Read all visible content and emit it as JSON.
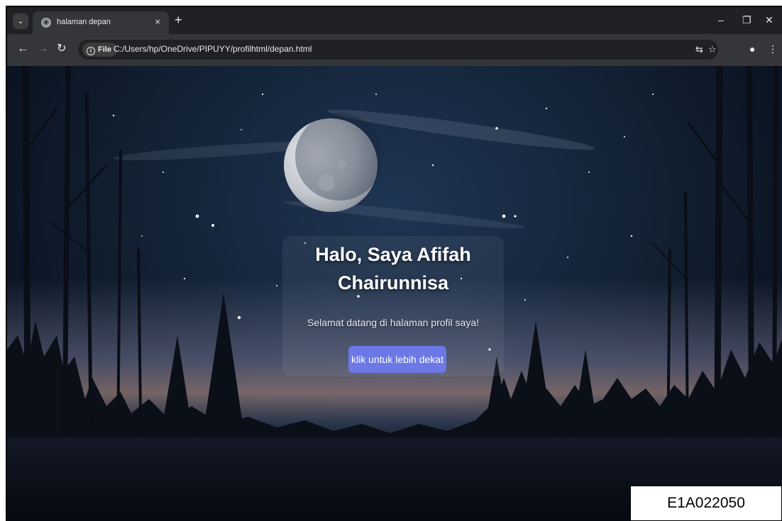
{
  "browser": {
    "tab_title": "halaman depan",
    "tab_close": "×",
    "new_tab": "+",
    "chip_label": "File",
    "address": "C:/Users/hp/OneDrive/PIPUYY/profilhtml/depan.html",
    "icons": [
      "tab-list-icon",
      "globe-icon",
      "back-icon",
      "forward-icon",
      "reload-icon",
      "info-icon",
      "translate-icon",
      "star-icon",
      "profile-icon",
      "menu-icon",
      "minimize-icon",
      "restore-icon",
      "close-icon"
    ]
  },
  "hero": {
    "title": "Halo, Saya Afifah Chairunnisa",
    "subtitle": "Selamat datang di halaman profil saya!",
    "button_label": "klik untuk lebih dekat"
  },
  "label": {
    "id": "E1A022050"
  },
  "colors": {
    "button": "#6c78e6",
    "chrome_dark": "#202124",
    "chrome_toolbar": "#35363a",
    "sky": "#142438"
  }
}
